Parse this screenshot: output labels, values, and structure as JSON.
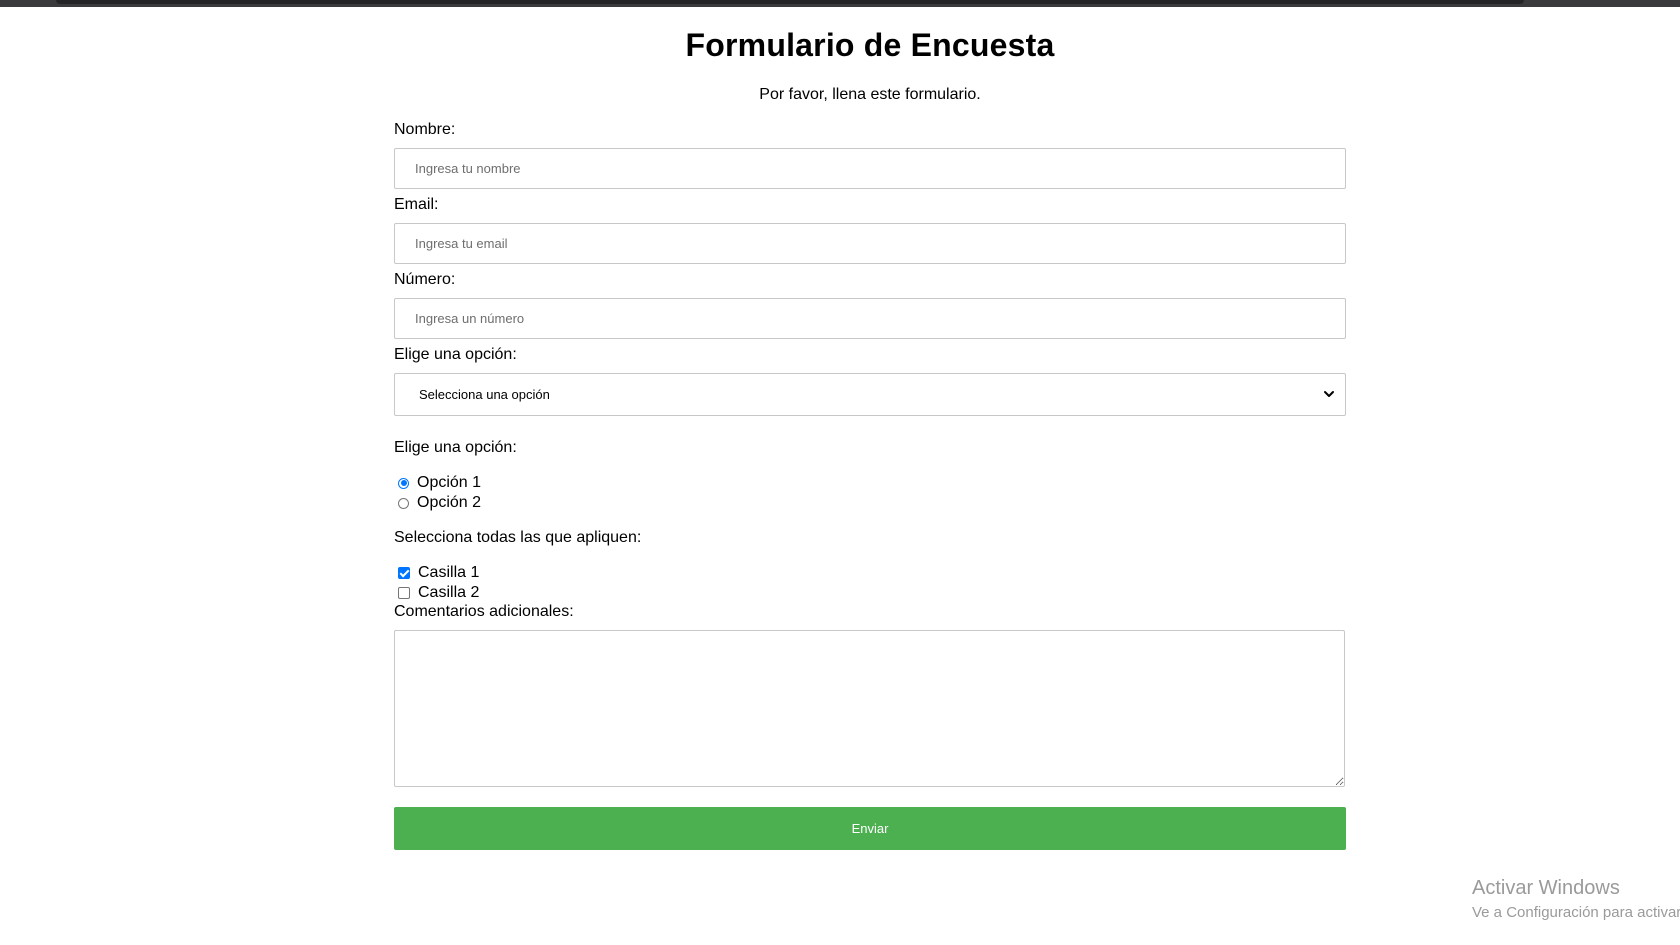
{
  "form": {
    "title": "Formulario de Encuesta",
    "subtitle": "Por favor, llena este formulario.",
    "name_label": "Nombre:",
    "name_placeholder": "Ingresa tu nombre",
    "email_label": "Email:",
    "email_placeholder": "Ingresa tu email",
    "number_label": "Número:",
    "number_placeholder": "Ingresa un número",
    "select_label": "Elige una opción:",
    "select_value": "Selecciona una opción",
    "radio_label": "Elige una opción:",
    "radio_options": [
      {
        "label": "Opción 1",
        "checked": true
      },
      {
        "label": "Opción 2",
        "checked": false
      }
    ],
    "checkbox_label": "Selecciona todas las que apliquen:",
    "checkbox_options": [
      {
        "label": "Casilla 1",
        "checked": true
      },
      {
        "label": "Casilla 2",
        "checked": false
      }
    ],
    "comments_label": "Comentarios adicionales:",
    "comments_value": "",
    "submit_label": "Enviar"
  },
  "watermark": {
    "line1": "Activar Windows",
    "line2": "Ve a Configuración para activar"
  },
  "colors": {
    "submit_bg": "#4caf50",
    "accent": "#0075ff"
  }
}
